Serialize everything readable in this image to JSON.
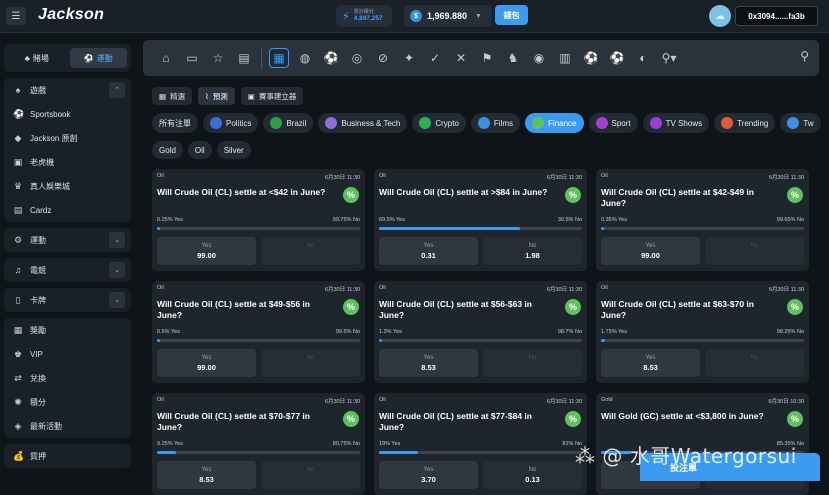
{
  "header": {
    "logo": "Jackson",
    "stat_label": "累計積分",
    "stat_value": "4,897,257",
    "balance": "1,969.880",
    "wallet_label": "錢包",
    "address": "0x3094......fa3b"
  },
  "sidebar": {
    "tab_casino": "賭場",
    "tab_sports": "運動",
    "group1": [
      {
        "icon": "cards-icon",
        "glyph": "♠",
        "label": "遊戲"
      },
      {
        "icon": "sportsbook-icon",
        "glyph": "⚽",
        "label": "Sportsbook"
      },
      {
        "icon": "jackson-original-icon",
        "glyph": "◆",
        "label": "Jackson 原創"
      },
      {
        "icon": "slots-icon",
        "glyph": "▣",
        "label": "老虎機"
      },
      {
        "icon": "live-casino-icon",
        "glyph": "♛",
        "label": "真人娛樂城"
      },
      {
        "icon": "cardz-icon",
        "glyph": "▤",
        "label": "Cardz"
      }
    ],
    "group2_label": "運動",
    "group3_label": "電競",
    "group4_label": "卡牌",
    "group5": [
      {
        "icon": "rewards-icon",
        "glyph": "▦",
        "label": "獎勵"
      },
      {
        "icon": "vip-icon",
        "glyph": "♚",
        "label": "VIP"
      },
      {
        "icon": "redeem-icon",
        "glyph": "⇄",
        "label": "兌換"
      },
      {
        "icon": "points-icon",
        "glyph": "✺",
        "label": "積分"
      },
      {
        "icon": "events-icon",
        "glyph": "◈",
        "label": "最新活動"
      }
    ],
    "pledge_label": "質押"
  },
  "modes": {
    "featured": "精選",
    "predict": "預測",
    "create": "賽事建立器"
  },
  "categories": [
    {
      "label": "所有注單",
      "color": ""
    },
    {
      "label": "Politics",
      "color": "#3a6fd8"
    },
    {
      "label": "Brazil",
      "color": "#2e9e44"
    },
    {
      "label": "Business & Tech",
      "color": "#8a6fd6"
    },
    {
      "label": "Crypto",
      "color": "#2fae5a"
    },
    {
      "label": "Films",
      "color": "#3d8fe0"
    },
    {
      "label": "Finance",
      "color": "#5cc35c"
    },
    {
      "label": "Sport",
      "color": "#a83dd8"
    },
    {
      "label": "TV Shows",
      "color": "#9b3dd8"
    },
    {
      "label": "Trending",
      "color": "#e05a3d"
    },
    {
      "label": "Tw",
      "color": "#3d8fe0"
    }
  ],
  "subcategories": [
    "Gold",
    "Oil",
    "Silver"
  ],
  "cards": [
    {
      "tag": "Oil",
      "date": "6月30日 11:30",
      "question": "Will Crude Oil (CL) settle at <$42 in June?",
      "yes_pct": "0.25% Yes",
      "no_pct": "99.75% No",
      "fill": 0.0025,
      "yes_label": "Yes",
      "yes_odds": "99.00",
      "no_label": "No",
      "no_odds": "-",
      "no_dim": true
    },
    {
      "tag": "Oil",
      "date": "6月30日 11:30",
      "question": "Will Crude Oil (CL) settle at >$84 in June?",
      "yes_pct": "69.5% Yes",
      "no_pct": "30.5% No",
      "fill": 0.695,
      "yes_label": "Yes",
      "yes_odds": "0.31",
      "no_label": "No",
      "no_odds": "1.98",
      "no_dim": false
    },
    {
      "tag": "Oil",
      "date": "6月30日 11:30",
      "question": "Will Crude Oil (CL) settle at $42-$49 in June?",
      "yes_pct": "0.35% Yes",
      "no_pct": "99.65% No",
      "fill": 0.0035,
      "yes_label": "Yes",
      "yes_odds": "99.00",
      "no_label": "No",
      "no_odds": "-",
      "no_dim": true
    },
    {
      "tag": "Oil",
      "date": "6月30日 11:30",
      "question": "Will Crude Oil (CL) settle at $49-$56 in June?",
      "yes_pct": "0.5% Yes",
      "no_pct": "99.5% No",
      "fill": 0.005,
      "yes_label": "Yes",
      "yes_odds": "99.00",
      "no_label": "No",
      "no_odds": "-",
      "no_dim": true
    },
    {
      "tag": "Oil",
      "date": "6月30日 11:30",
      "question": "Will Crude Oil (CL) settle at $56-$63 in June?",
      "yes_pct": "1.3% Yes",
      "no_pct": "98.7% No",
      "fill": 0.013,
      "yes_label": "Yes",
      "yes_odds": "8.53",
      "no_label": "No",
      "no_odds": "-",
      "no_dim": true
    },
    {
      "tag": "Oil",
      "date": "6月30日 11:30",
      "question": "Will Crude Oil (CL) settle at $63-$70 in June?",
      "yes_pct": "1.75% Yes",
      "no_pct": "98.25% No",
      "fill": 0.0175,
      "yes_label": "Yes",
      "yes_odds": "8.53",
      "no_label": "No",
      "no_odds": "-",
      "no_dim": true
    },
    {
      "tag": "Oil",
      "date": "6月30日 11:30",
      "question": "Will Crude Oil (CL) settle at $70-$77 in June?",
      "yes_pct": "9.25% Yes",
      "no_pct": "80.75% No",
      "fill": 0.0925,
      "yes_label": "Yes",
      "yes_odds": "8.53",
      "no_label": "No",
      "no_odds": "-",
      "no_dim": true
    },
    {
      "tag": "Oil",
      "date": "6月30日 11:30",
      "question": "Will Crude Oil (CL) settle at $77-$84 in June?",
      "yes_pct": "19% Yes",
      "no_pct": "81% No",
      "fill": 0.19,
      "yes_label": "Yes",
      "yes_odds": "3.70",
      "no_label": "No",
      "no_odds": "0.13",
      "no_dim": false
    },
    {
      "tag": "Gold",
      "date": "6月30日 10:30",
      "question": "Will Gold (GC) settle at <$3,800 in June?",
      "yes_pct": "",
      "no_pct": "85.35% No",
      "fill": 0.1465,
      "yes_label": "Yes",
      "yes_odds": "",
      "no_label": "No",
      "no_odds": "",
      "no_dim": true
    }
  ],
  "betslip_label": "投注單",
  "watermark": "⁂ @ 水哥Watergorsui"
}
